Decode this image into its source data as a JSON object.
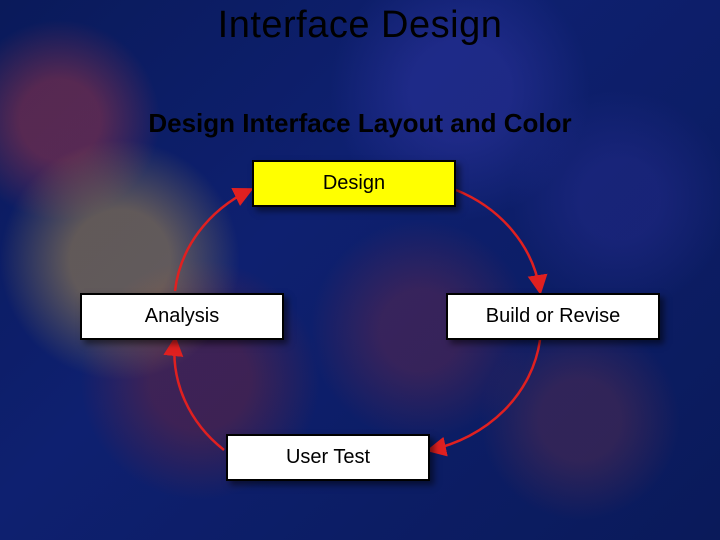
{
  "title": "Interface Design",
  "subtitle": "Design Interface Layout and Color",
  "nodes": {
    "design": {
      "label": "Design"
    },
    "analysis": {
      "label": "Analysis"
    },
    "build": {
      "label": "Build or Revise"
    },
    "usertest": {
      "label": "User Test"
    }
  },
  "cycle": {
    "order": [
      "design",
      "build",
      "usertest",
      "analysis"
    ],
    "direction": "clockwise",
    "arrowColor": "#e02020"
  }
}
